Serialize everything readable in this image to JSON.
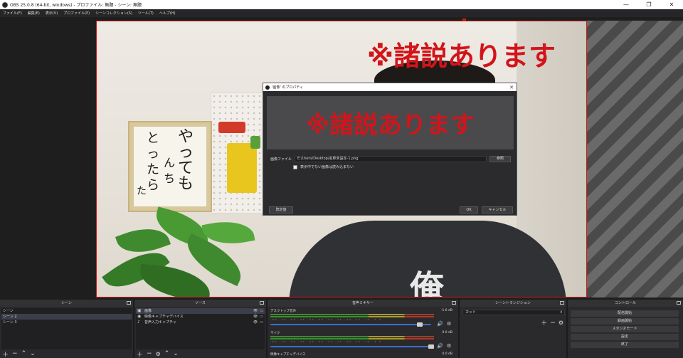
{
  "window": {
    "title": "OBS 25.0.8 (64-bit, windows) - プロファイル: 無題 - シーン: 無題",
    "minimize": "—",
    "maximize": "❐",
    "close": "✕"
  },
  "menu": [
    "ファイル(F)",
    "編集(E)",
    "表示(V)",
    "プロファイル(P)",
    "シーンコレクション(S)",
    "ツール(T)",
    "ヘルプ(H)"
  ],
  "preview": {
    "overlay_text": "※諸説あります",
    "calligraphy": [
      "やっても",
      "んち",
      "とったら",
      "た"
    ],
    "shirt_kanji": "俺"
  },
  "dialog": {
    "title": "'画像' のプロパティ",
    "close": "✕",
    "preview_text": "※諸説あります",
    "file_label": "画像ファイル",
    "file_value": "E:/Users/Desktop/名称未設定-1.png",
    "browse_label": "参照",
    "unload_checkbox_label": "表示中でない画像は読み込まない",
    "defaults_label": "既定値",
    "ok_label": "OK",
    "cancel_label": "キャンセル"
  },
  "docks": {
    "scenes": {
      "title": "シーン",
      "items": [
        "シーン",
        "シーン 2",
        "シーン 3"
      ],
      "selected": 1
    },
    "sources": {
      "title": "ソース",
      "items": [
        {
          "icon": "image-icon",
          "glyph": "▣",
          "name": "画像"
        },
        {
          "icon": "camera-icon",
          "glyph": "◉",
          "name": "映像キャプチャデバイス"
        },
        {
          "icon": "mic-icon",
          "glyph": "♪",
          "name": "音声入力キャプチャ"
        }
      ]
    },
    "mixer": {
      "title": "音声ミキサー",
      "scale": "-60 -55 -50 -45 -40 -35 -30 -25 -20 -15 -10 -5 0",
      "channels": [
        {
          "name": "デスクトップ音声",
          "db": "-1.6 dB",
          "level": 0.98
        },
        {
          "name": "マイク",
          "db": "0.0 dB",
          "level": 0.98
        },
        {
          "name": "映像キャプチャデバイス",
          "db": "0.0 dB",
          "level": 0.98
        }
      ]
    },
    "transitions": {
      "title": "シーントランジション",
      "selected": "カット"
    },
    "controls": {
      "title": "コントロール",
      "buttons": [
        "配信開始",
        "録画開始",
        "スタジオモード",
        "設定",
        "終了"
      ]
    }
  }
}
